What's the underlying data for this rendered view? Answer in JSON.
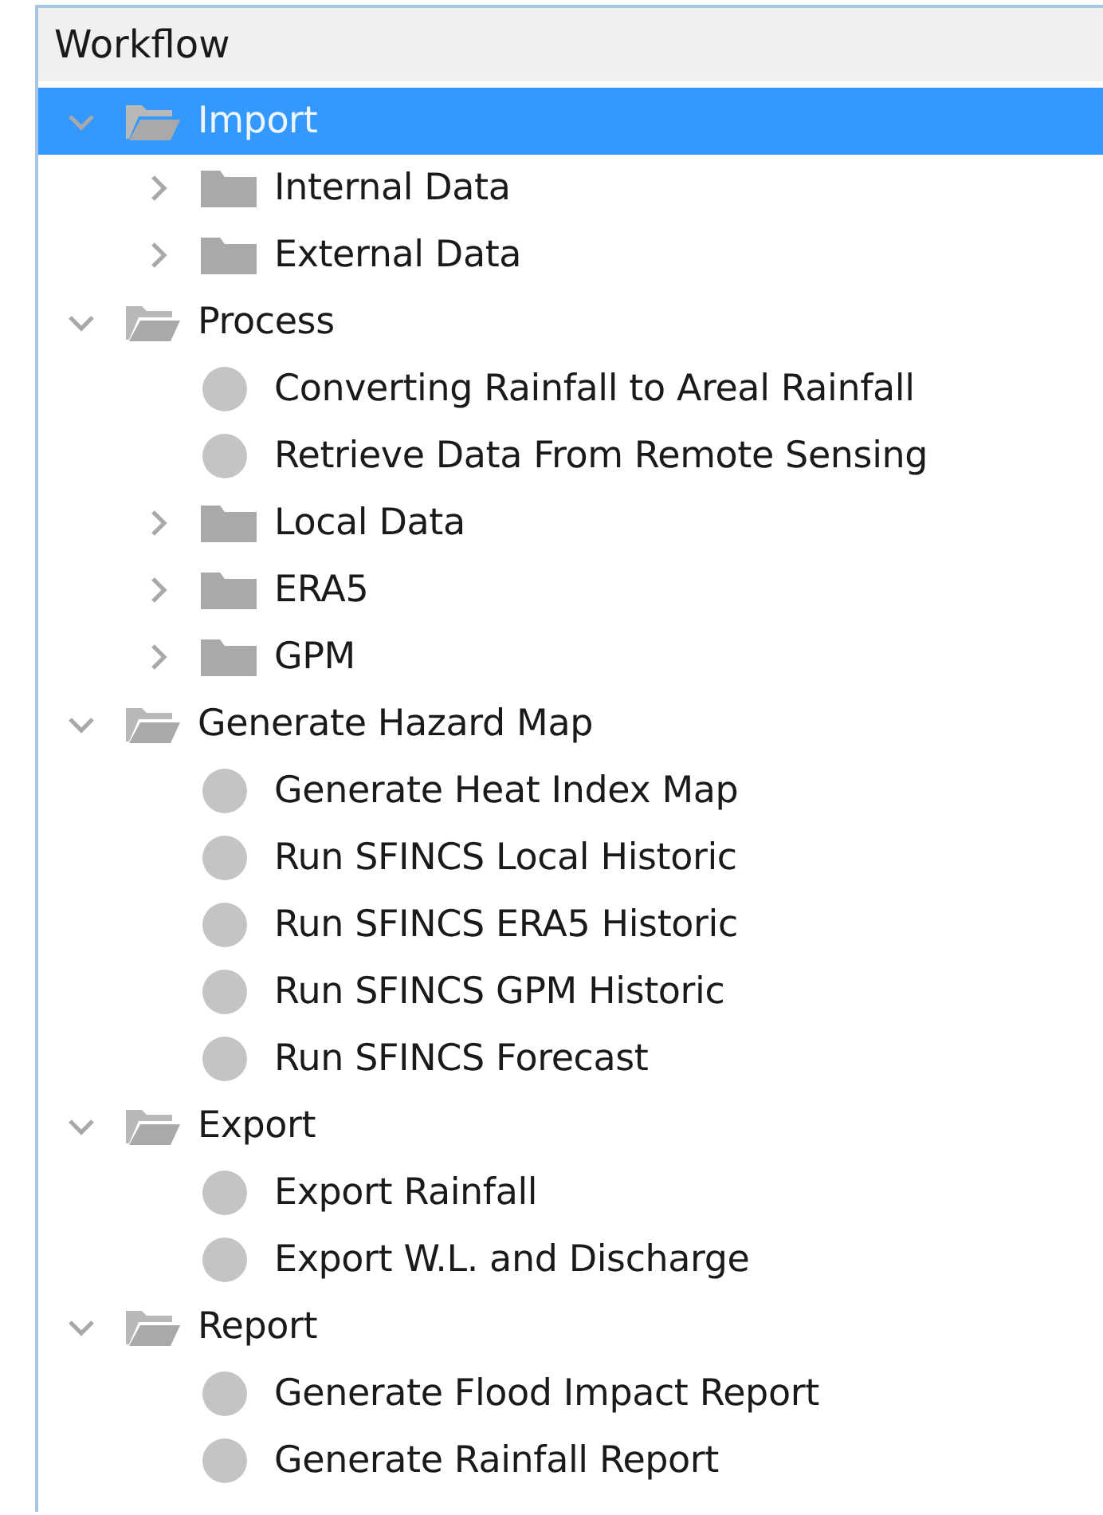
{
  "panel": {
    "title": "Workflow"
  },
  "tree": [
    {
      "label": "Import",
      "kind": "folder",
      "expanded": true,
      "selected": true,
      "children": [
        {
          "label": "Internal Data",
          "kind": "folder",
          "expanded": false,
          "selected": false
        },
        {
          "label": "External Data",
          "kind": "folder",
          "expanded": false,
          "selected": false
        }
      ]
    },
    {
      "label": "Process",
      "kind": "folder",
      "expanded": true,
      "selected": false,
      "children": [
        {
          "label": "Converting Rainfall to Areal Rainfall",
          "kind": "task",
          "selected": false
        },
        {
          "label": "Retrieve Data From Remote Sensing",
          "kind": "task",
          "selected": false
        },
        {
          "label": "Local Data",
          "kind": "folder",
          "expanded": false,
          "selected": false
        },
        {
          "label": "ERA5",
          "kind": "folder",
          "expanded": false,
          "selected": false
        },
        {
          "label": "GPM",
          "kind": "folder",
          "expanded": false,
          "selected": false
        }
      ]
    },
    {
      "label": "Generate Hazard Map",
      "kind": "folder",
      "expanded": true,
      "selected": false,
      "children": [
        {
          "label": "Generate Heat Index Map",
          "kind": "task",
          "selected": false
        },
        {
          "label": "Run SFINCS Local Historic",
          "kind": "task",
          "selected": false
        },
        {
          "label": "Run SFINCS ERA5 Historic",
          "kind": "task",
          "selected": false
        },
        {
          "label": "Run SFINCS GPM Historic",
          "kind": "task",
          "selected": false
        },
        {
          "label": "Run SFINCS Forecast",
          "kind": "task",
          "selected": false
        }
      ]
    },
    {
      "label": "Export",
      "kind": "folder",
      "expanded": true,
      "selected": false,
      "children": [
        {
          "label": "Export Rainfall",
          "kind": "task",
          "selected": false
        },
        {
          "label": "Export W.L. and Discharge",
          "kind": "task",
          "selected": false
        }
      ]
    },
    {
      "label": "Report",
      "kind": "folder",
      "expanded": true,
      "selected": false,
      "children": [
        {
          "label": "Generate Flood Impact Report",
          "kind": "task",
          "selected": false
        },
        {
          "label": "Generate Rainfall Report",
          "kind": "task",
          "selected": false
        }
      ]
    }
  ]
}
